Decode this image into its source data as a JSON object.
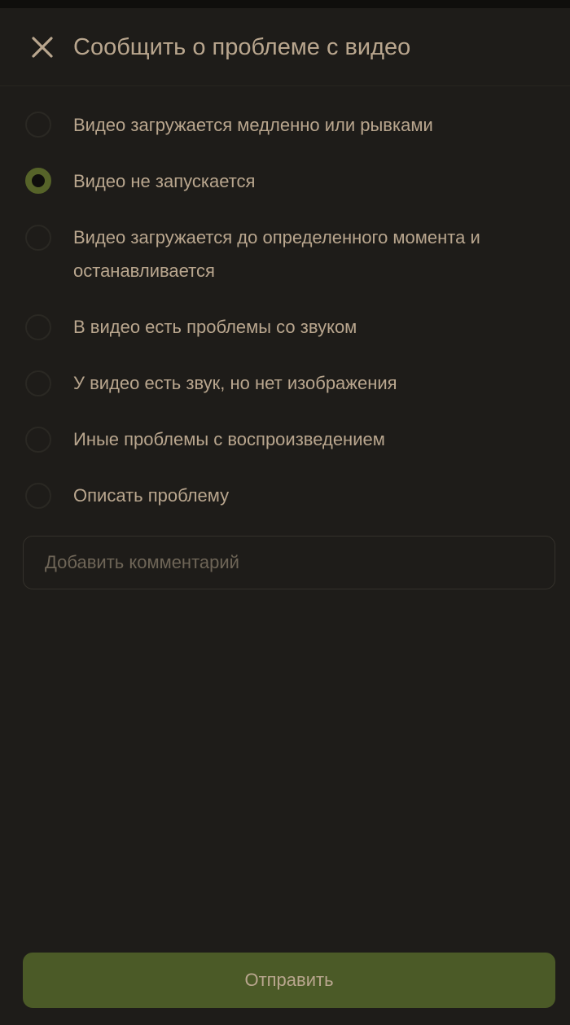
{
  "header": {
    "close_icon": "close-icon",
    "title": "Сообщить о проблеме с видео"
  },
  "options": [
    {
      "label": "Видео загружается медленно или рывками",
      "selected": false
    },
    {
      "label": "Видео не запускается",
      "selected": true
    },
    {
      "label": "Видео загружается до определенного момента и останавливается",
      "selected": false
    },
    {
      "label": "В видео есть проблемы со звуком",
      "selected": false
    },
    {
      "label": "У видео есть звук, но нет изображения",
      "selected": false
    },
    {
      "label": "Иные проблемы с воспроизведением",
      "selected": false
    },
    {
      "label": "Описать проблему",
      "selected": false
    }
  ],
  "comment": {
    "value": "",
    "placeholder": "Добавить комментарий"
  },
  "submit": {
    "label": "Отправить"
  },
  "colors": {
    "background": "#1e1c19",
    "text": "#b9a68e",
    "accent": "#566329",
    "button": "#4b5a27"
  }
}
